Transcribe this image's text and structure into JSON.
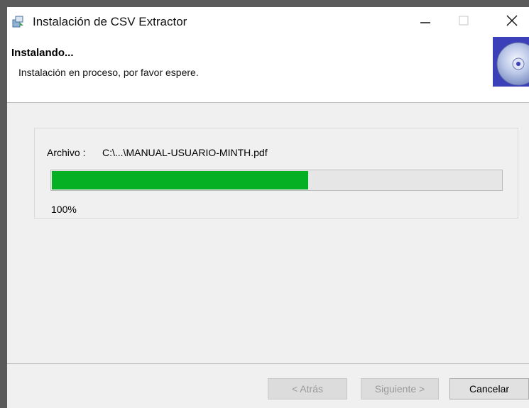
{
  "window": {
    "title": "Instalación de  CSV Extractor",
    "controls": {
      "minimize": "minimize-icon",
      "maximize": "maximize-icon",
      "close": "close-icon"
    }
  },
  "header": {
    "title": "Instalando...",
    "subtitle": "Instalación en proceso, por favor espere."
  },
  "progress": {
    "file_label": "Archivo :",
    "file_path": "C:\\...\\MANUAL-USUARIO-MINTH.pdf",
    "percent_text": "100%",
    "fill_fraction": 0.57,
    "fill_color": "#06b025"
  },
  "buttons": {
    "back": "< Atrás",
    "next": "Siguiente >",
    "cancel": "Cancelar"
  },
  "colors": {
    "banner_blue": "#3b3fb8"
  }
}
